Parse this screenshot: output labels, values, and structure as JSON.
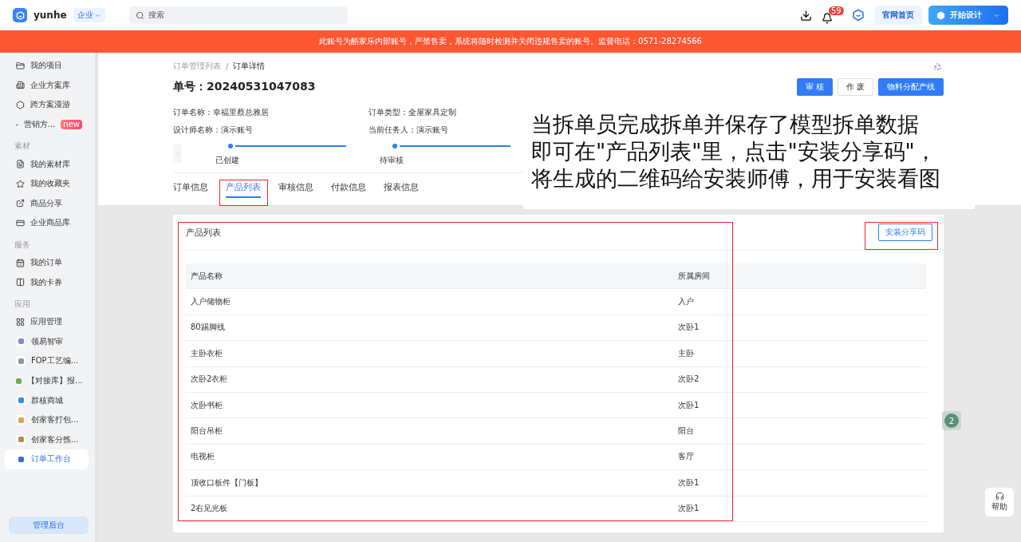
{
  "topbar": {
    "brand": "yunhe",
    "org": {
      "label": "企业",
      "expanded": false
    },
    "search": {
      "placeholder": "搜索"
    },
    "notifications": "59",
    "links": [
      {
        "label": "官网首页",
        "kind": "plain"
      },
      {
        "label": "开始设计",
        "kind": "primary"
      }
    ]
  },
  "banner": "此账号为酷家乐内部账号，严禁售卖，系统将随时检测并关闭违规售卖的账号。监督电话：0571-28274566",
  "sidebar": {
    "sections": [
      {
        "items": [
          {
            "label": "我的项目",
            "kind": "nav",
            "selected": false
          },
          {
            "label": "企业方案库",
            "kind": "nav",
            "selected": false
          },
          {
            "label": "跨方案漫游",
            "kind": "nav",
            "selected": false
          },
          {
            "label": "营销方...",
            "kind": "nav",
            "selected": false,
            "badge": "new"
          }
        ]
      },
      {
        "title": "素材",
        "items": [
          {
            "label": "我的素材库",
            "kind": "nav",
            "selected": false
          },
          {
            "label": "我的收藏夹",
            "kind": "nav",
            "selected": false
          },
          {
            "label": "商品分享",
            "kind": "nav",
            "selected": false
          },
          {
            "label": "企业商品库",
            "kind": "nav",
            "selected": false
          }
        ]
      },
      {
        "title": "服务",
        "items": [
          {
            "label": "我的订单",
            "kind": "nav",
            "selected": false
          },
          {
            "label": "我的卡券",
            "kind": "nav",
            "selected": false
          }
        ]
      },
      {
        "title": "应用",
        "items": [
          {
            "label": "应用管理",
            "kind": "nav",
            "selected": false
          },
          {
            "label": "领易智审",
            "kind": "app",
            "selected": false
          },
          {
            "label": "FOP工艺编...",
            "kind": "app",
            "selected": false
          },
          {
            "label": "【对接库】报...",
            "kind": "app",
            "selected": false
          },
          {
            "label": "群核商城",
            "kind": "app",
            "selected": false
          },
          {
            "label": "创家客打包...",
            "kind": "app",
            "selected": false
          },
          {
            "label": "创家客分拣...",
            "kind": "app",
            "selected": false
          },
          {
            "label": "订单工作台",
            "kind": "app",
            "selected": true
          }
        ]
      }
    ],
    "footer": "管理后台"
  },
  "breadcrumb": [
    "订单管理列表",
    "/",
    "订单详情"
  ],
  "order": {
    "label": "单号：",
    "number": "20240531047083"
  },
  "actions": [
    {
      "label": "审 核",
      "kind": "primary"
    },
    {
      "label": "作 废",
      "kind": "default"
    },
    {
      "label": "物料分配产线",
      "kind": "primary"
    }
  ],
  "fields": [
    {
      "label": "订单名称：",
      "value": "幸福里蔡总雅居"
    },
    {
      "label": "订单类型：",
      "value": "全屋家具定制"
    },
    {
      "label": "设计师名称：",
      "value": "演示账号"
    },
    {
      "label": "当前任务人：",
      "value": "演示账号"
    }
  ],
  "steps": [
    "已创建",
    "待审核"
  ],
  "tabs": [
    {
      "label": "订单信息",
      "selected": false
    },
    {
      "label": "产品列表",
      "selected": true
    },
    {
      "label": "审核信息",
      "selected": false
    },
    {
      "label": "付款信息",
      "selected": false
    },
    {
      "label": "报表信息",
      "selected": false
    }
  ],
  "products": {
    "title": "产品列表",
    "button": "安装分享码",
    "columns": [
      "产品名称",
      "所属房间"
    ],
    "rows": [
      [
        "入户储物柜",
        "入户"
      ],
      [
        "80踢脚线",
        "次卧1"
      ],
      [
        "主卧衣柜",
        "主卧"
      ],
      [
        "次卧2衣柜",
        "次卧2"
      ],
      [
        "次卧书柜",
        "次卧1"
      ],
      [
        "阳台吊柜",
        "阳台"
      ],
      [
        "电视柜",
        "客厅"
      ],
      [
        "顶收口板件【门板】",
        "次卧1"
      ],
      [
        "2右见光板",
        "次卧1"
      ]
    ]
  },
  "callout": [
    "当拆单员完成拆单并保存了模型拆单数据",
    "即可在\"产品列表\"里，点击\"安装分享码\"，",
    "将生成的二维码给安装师傅，用于安装看图"
  ],
  "float_badge": "2",
  "help": "帮助"
}
